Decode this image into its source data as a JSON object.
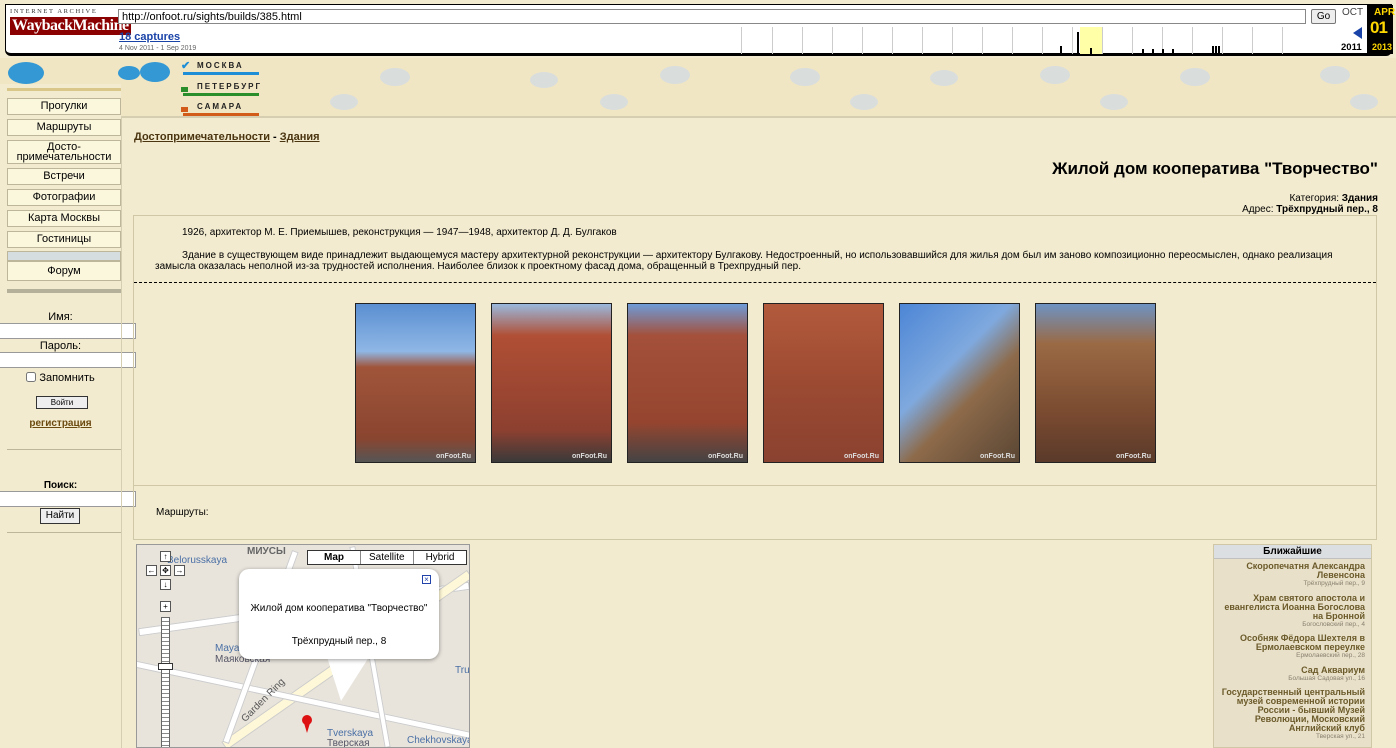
{
  "wayback": {
    "logo_top": "INTERNET ARCHIVE",
    "logo_main": "WaybackMachine",
    "url": "http://onfoot.ru/sights/builds/385.html",
    "go": "Go",
    "captures": "18 captures",
    "range": "4 Nov 2011 - 1 Sep 2019",
    "prev_month": "OCT",
    "cur_month": "APR",
    "day": "01",
    "prev_year": "2011",
    "cur_year": "2013"
  },
  "cities": [
    "МОСКВА",
    "ПЕТЕРБУРГ",
    "САМАРА"
  ],
  "colors": {
    "moscow": "#1e8fd6",
    "peter": "#2a8f2a",
    "samara": "#d25b1a",
    "accent": "#f3ebcf"
  },
  "nav": [
    "Прогулки",
    "Маршруты",
    "Досто-примечательности",
    "Встречи",
    "Фотографии",
    "Карта Москвы",
    "Гостиницы",
    "Форум"
  ],
  "login": {
    "name_label": "Имя:",
    "pass_label": "Пароль:",
    "remember": "Запомнить",
    "submit": "Войти",
    "register": "регистрация"
  },
  "search": {
    "label": "Поиск:",
    "button": "Найти"
  },
  "breadcrumb": {
    "root": "Достопримечательности",
    "sep": " - ",
    "current": "Здания"
  },
  "page": {
    "title": "Жилой дом кооператива \"Творчество\"",
    "category_label": "Категория: ",
    "category": "Здания",
    "address_label": "Адрес: ",
    "address": "Трёхпрудный пер., 8",
    "years": "1926, архитектор М. Е. Приемышев, реконструкция — 1947—1948, архитектор Д. Д. Булгаков",
    "description": "Здание в существующем виде принадлежит выдающемуся мастеру архитектурной реконструкции — архитектору Булгакову. Недостроенный, но использовавшийся для жилья дом был им заново композиционно переосмыслен, однако реализация замысла оказалась неполной из-за трудностей исполнения. Наиболее близок к проектному фасад дома, обращенный в Трехпрудный пер.",
    "photo_watermark": "onFoot.Ru",
    "routes_label": "Маршруты:"
  },
  "map": {
    "types": [
      "Map",
      "Satellite",
      "Hybrid"
    ],
    "bubble_title": "Жилой дом кооператива \"Творчество\"",
    "bubble_address": "Трёхпрудный пер., 8",
    "labels": [
      "МИУСЫ",
      "Belorusskaya",
      "Mayakovskaya",
      "Маяковская",
      "Garden Ring",
      "Tverskaya",
      "Тверская",
      "Chekhovskaya",
      "Tru"
    ]
  },
  "nearby": {
    "title": "Ближайшие",
    "items": [
      {
        "name": "Скоропечатня Александра Левенсона",
        "street": "Трёхпрудный пер., 9"
      },
      {
        "name": "Храм святого апостола и евангелиста Иоанна Богослова на Бронной",
        "street": "Богословский пер., 4"
      },
      {
        "name": "Особняк Фёдора Шехтеля в Ермолаевском переулке",
        "street": "Ермолаевский пер., 28"
      },
      {
        "name": "Сад Аквариум",
        "street": "Большая Садовая ул., 16"
      },
      {
        "name": "Государственный центральный музей современной истории России - бывший Музей Революции, Московский Английский клуб",
        "street": "Тверская ул., 21"
      }
    ]
  }
}
